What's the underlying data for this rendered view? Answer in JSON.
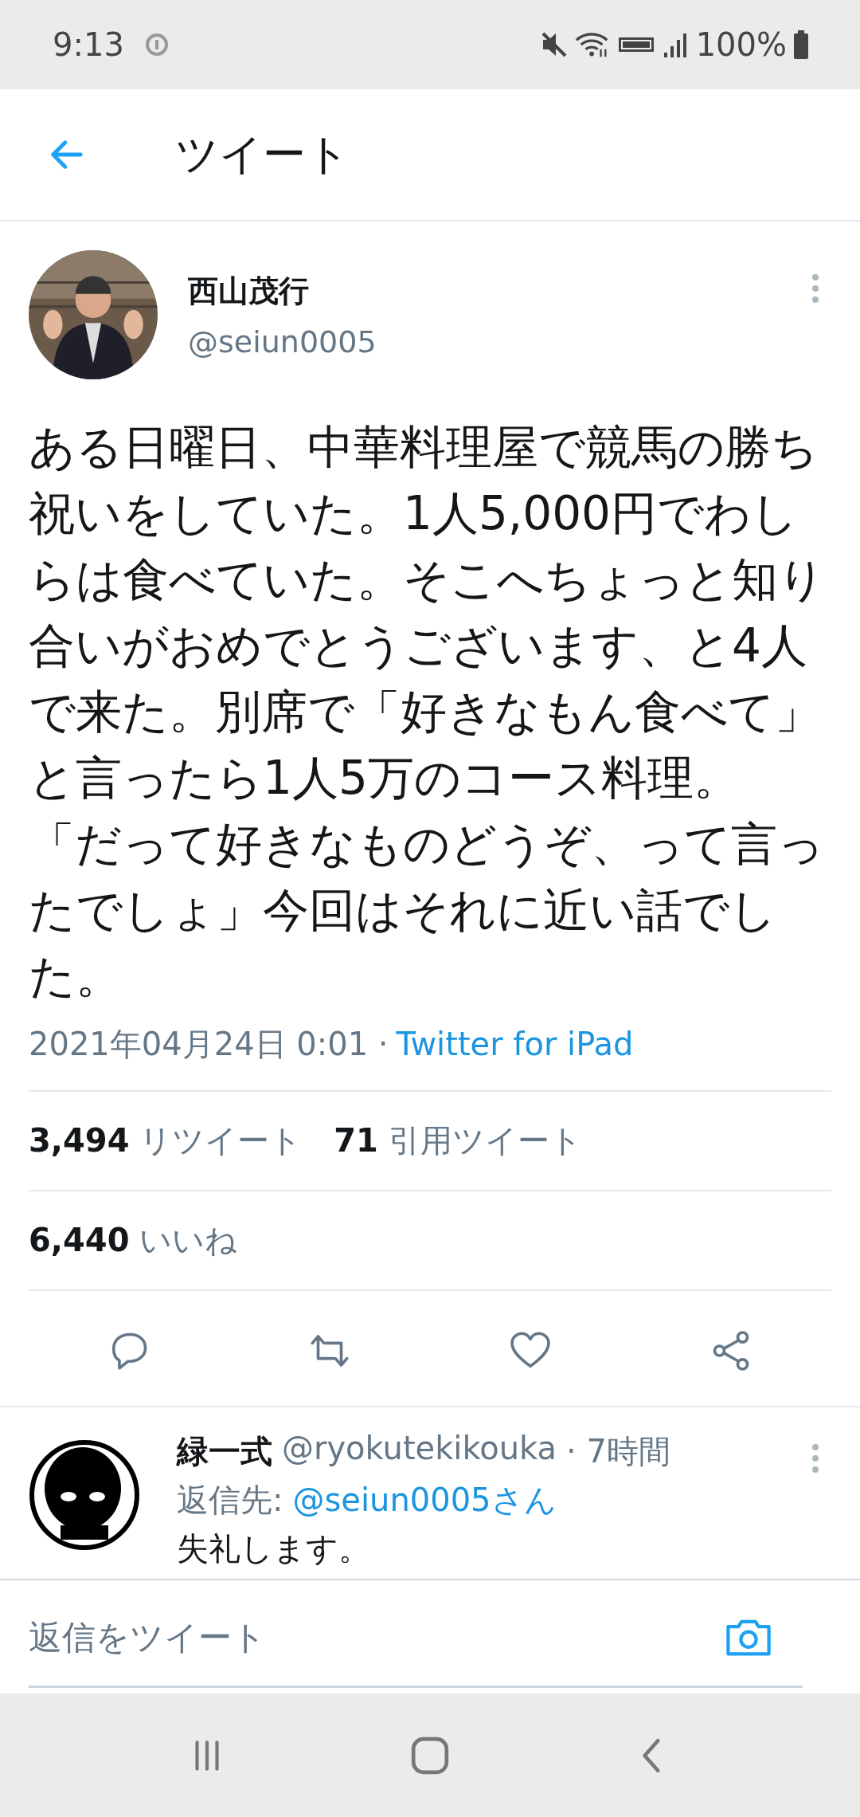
{
  "status_bar": {
    "time": "9:13",
    "battery": "100%"
  },
  "header": {
    "title": "ツイート"
  },
  "tweet": {
    "author": {
      "name": "西山茂行",
      "handle": "@seiun0005"
    },
    "text": "ある日曜日、中華料理屋で競馬の勝ち祝いをしていた。1人5,000円でわしらは食べていた。そこへちょっと知り合いがおめでとうございます、と4人で来た。別席で「好きなもん食べて」と言ったら1人5万のコース料理。「だって好きなものどうぞ、って言ったでしょ」今回はそれに近い話でした。",
    "timestamp": "2021年04月24日 0:01 ·",
    "source": "Twitter for iPad",
    "stats": [
      {
        "count": "3,494",
        "label": "リツイート"
      },
      {
        "count": "71",
        "label": "引用ツイート"
      }
    ],
    "likes": {
      "count": "6,440",
      "label": "いいね"
    }
  },
  "reply": {
    "name": "緑一式",
    "handle": "@ryokutekikouka",
    "time": "· 7時間",
    "reply_to_label": "返信先:",
    "reply_to": "@seiun0005さん",
    "text": "失礼します。"
  },
  "composer": {
    "placeholder": "返信をツイート"
  }
}
